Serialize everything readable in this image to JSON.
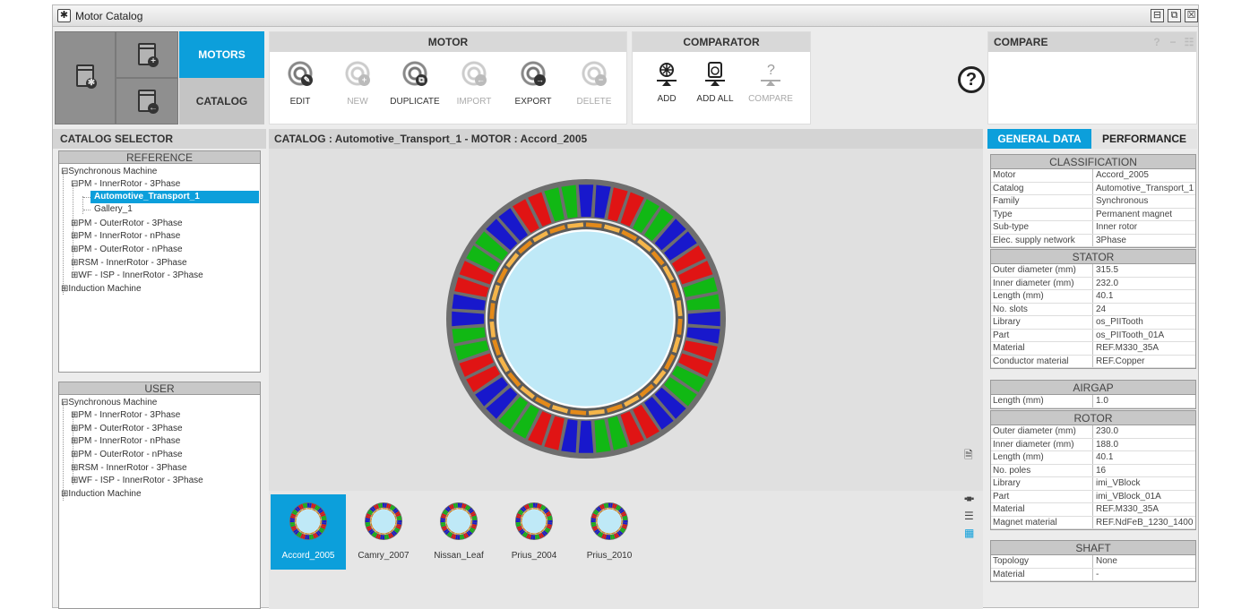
{
  "window": {
    "title": "Motor Catalog",
    "buttons": [
      "⊟",
      "⧉",
      "☒"
    ]
  },
  "ribbon": {
    "nav": {
      "motors": "MOTORS",
      "catalog": "CATALOG"
    },
    "motor_group": {
      "title": "MOTOR",
      "tools": [
        {
          "label": "EDIT",
          "enabled": true,
          "badge": "✎"
        },
        {
          "label": "NEW",
          "enabled": false,
          "badge": "+"
        },
        {
          "label": "DUPLICATE",
          "enabled": true,
          "badge": "⧉"
        },
        {
          "label": "IMPORT",
          "enabled": false,
          "badge": "←"
        },
        {
          "label": "EXPORT",
          "enabled": true,
          "badge": "→"
        },
        {
          "label": "DELETE",
          "enabled": false,
          "badge": "−"
        }
      ]
    },
    "comparator_group": {
      "title": "COMPARATOR",
      "tools": [
        {
          "label": "ADD",
          "enabled": true
        },
        {
          "label": "ADD ALL",
          "enabled": true
        },
        {
          "label": "COMPARE",
          "enabled": false
        }
      ]
    },
    "help": "?"
  },
  "compare_panel": {
    "title": "COMPARE",
    "icons": [
      "?",
      "−",
      "☷"
    ]
  },
  "catalog_selector": {
    "title": "CATALOG SELECTOR",
    "reference": {
      "title": "REFERENCE",
      "root": "Synchronous Machine",
      "items": [
        "PM - InnerRotor - 3Phase",
        "Automotive_Transport_1",
        "Gallery_1",
        "PM - OuterRotor - 3Phase",
        "PM - InnerRotor - nPhase",
        "PM - OuterRotor - nPhase",
        "RSM - InnerRotor - 3Phase",
        "WF - ISP - InnerRotor - 3Phase"
      ],
      "induction": "Induction Machine"
    },
    "user": {
      "title": "USER",
      "root": "Synchronous Machine",
      "items": [
        "PM - InnerRotor - 3Phase",
        "PM - OuterRotor - 3Phase",
        "PM - InnerRotor - nPhase",
        "PM - OuterRotor - nPhase",
        "RSM - InnerRotor - 3Phase",
        "WF - ISP - InnerRotor - 3Phase"
      ],
      "induction": "Induction Machine"
    }
  },
  "viewer": {
    "header": "CATALOG : Automotive_Transport_1  -  MOTOR : Accord_2005",
    "colors": {
      "stator": "#6e6e6e",
      "bore": "#bfe9f7",
      "red": "#e01414",
      "green": "#11b814",
      "blue": "#1818cc",
      "magnet": "#f5b54a",
      "magnet_dark": "#e48a1a"
    },
    "thumbnails": [
      "Accord_2005",
      "Camry_2007",
      "Nissan_Leaf",
      "Prius_2004",
      "Prius_2010"
    ],
    "view_icons": [
      "doc-icon",
      "carousel-icon",
      "list-icon",
      "grid-icon"
    ]
  },
  "right_panel": {
    "tabs": [
      "GENERAL DATA",
      "PERFORMANCE"
    ],
    "sections": [
      {
        "title": "CLASSIFICATION",
        "rows": [
          [
            "Motor",
            "Accord_2005"
          ],
          [
            "Catalog",
            "Automotive_Transport_1"
          ],
          [
            "Family",
            "Synchronous"
          ],
          [
            "Type",
            "Permanent magnet"
          ],
          [
            "Sub-type",
            "Inner rotor"
          ],
          [
            "Elec. supply network",
            "3Phase"
          ]
        ]
      },
      {
        "title": "STATOR",
        "rows": [
          [
            "Outer diameter (mm)",
            "315.5"
          ],
          [
            "Inner diameter (mm)",
            "232.0"
          ],
          [
            "Length (mm)",
            "40.1"
          ],
          [
            "No. slots",
            "24"
          ],
          [
            "Library",
            "os_PIITooth"
          ],
          [
            "Part",
            "os_PIITooth_01A"
          ],
          [
            "Material",
            "REF.M330_35A"
          ],
          [
            "Conductor material",
            "REF.Copper"
          ]
        ]
      },
      {
        "title": "AIRGAP",
        "rows": [
          [
            "Length (mm)",
            "1.0"
          ]
        ]
      },
      {
        "title": "ROTOR",
        "rows": [
          [
            "Outer diameter (mm)",
            "230.0"
          ],
          [
            "Inner diameter (mm)",
            "188.0"
          ],
          [
            "Length (mm)",
            "40.1"
          ],
          [
            "No. poles",
            "16"
          ],
          [
            "Library",
            "imi_VBlock"
          ],
          [
            "Part",
            "imi_VBlock_01A"
          ],
          [
            "Material",
            "REF.M330_35A"
          ],
          [
            "Magnet material",
            "REF.NdFeB_1230_1400"
          ]
        ]
      },
      {
        "title": "SHAFT",
        "rows": [
          [
            "Topology",
            "None"
          ],
          [
            "Material",
            "-"
          ]
        ]
      }
    ]
  }
}
